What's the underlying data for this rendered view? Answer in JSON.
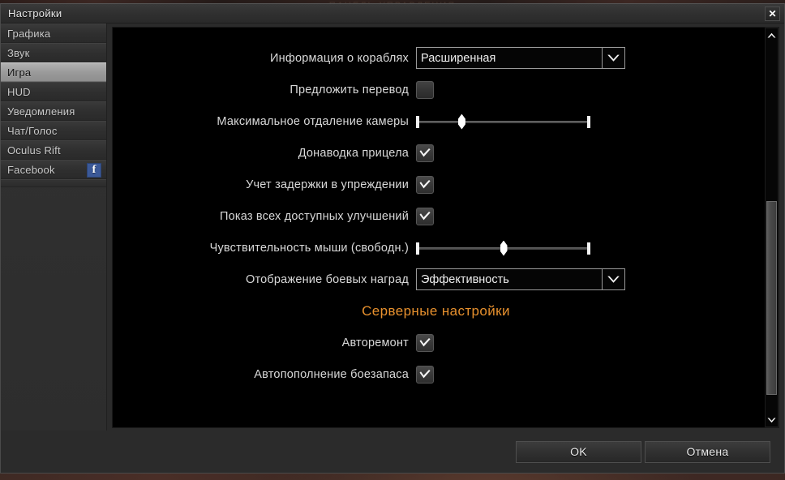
{
  "backdrop": {
    "obscured_title": "ПАНЕЛЬ УПРАВЛЕНИЯ"
  },
  "window": {
    "title": "Настройки",
    "close_label": "✕"
  },
  "sidebar": {
    "items": [
      {
        "label": "Графика",
        "selected": false,
        "icon": null
      },
      {
        "label": "Звук",
        "selected": false,
        "icon": null
      },
      {
        "label": "Игра",
        "selected": true,
        "icon": null
      },
      {
        "label": "HUD",
        "selected": false,
        "icon": null
      },
      {
        "label": "Уведомления",
        "selected": false,
        "icon": null
      },
      {
        "label": "Чат/Голос",
        "selected": false,
        "icon": null
      },
      {
        "label": "Oculus Rift",
        "selected": false,
        "icon": null
      },
      {
        "label": "Facebook",
        "selected": false,
        "icon": "facebook-icon",
        "icon_glyph": "f"
      }
    ]
  },
  "settings": {
    "rows": [
      {
        "label": "Информация о кораблях",
        "type": "dropdown",
        "value": "Расширенная",
        "name": "ship-info-dropdown"
      },
      {
        "label": "Предложить перевод",
        "type": "checkbox",
        "checked": false,
        "name": "offer-translation-checkbox"
      },
      {
        "label": "Максимальное отдаление камеры",
        "type": "slider",
        "value_percent": 26,
        "name": "max-camera-distance-slider"
      },
      {
        "label": "Донаводка прицела",
        "type": "checkbox",
        "checked": true,
        "name": "aim-assist-checkbox"
      },
      {
        "label": "Учет задержки в упреждении",
        "type": "checkbox",
        "checked": true,
        "name": "lead-latency-checkbox"
      },
      {
        "label": "Показ всех доступных улучшений",
        "type": "checkbox",
        "checked": true,
        "name": "show-all-upgrades-checkbox"
      },
      {
        "label": "Чувствительность мыши (свободн.)",
        "type": "slider",
        "value_percent": 50,
        "name": "mouse-sensitivity-slider"
      },
      {
        "label": "Отображение боевых наград",
        "type": "dropdown",
        "value": "Эффективность",
        "name": "battle-awards-dropdown"
      },
      {
        "label": "Серверные настройки",
        "type": "section",
        "name": "server-settings-header"
      },
      {
        "label": "Авторемонт",
        "type": "checkbox",
        "checked": true,
        "name": "auto-repair-checkbox"
      },
      {
        "label": "Автопополнение боезапаса",
        "type": "checkbox",
        "checked": true,
        "name": "auto-resupply-ammo-checkbox"
      }
    ]
  },
  "scrollbar": {
    "up_icon": "chevron-up-icon",
    "down_icon": "chevron-down-icon",
    "thumb_top_percent": 43,
    "thumb_height_percent": 52
  },
  "footer": {
    "ok_label": "OK",
    "cancel_label": "Отмена"
  },
  "colors": {
    "accent_orange": "#E8912E",
    "facebook_blue": "#3B5998",
    "panel_black": "#000000",
    "selected_item": "#9B9B9B"
  }
}
